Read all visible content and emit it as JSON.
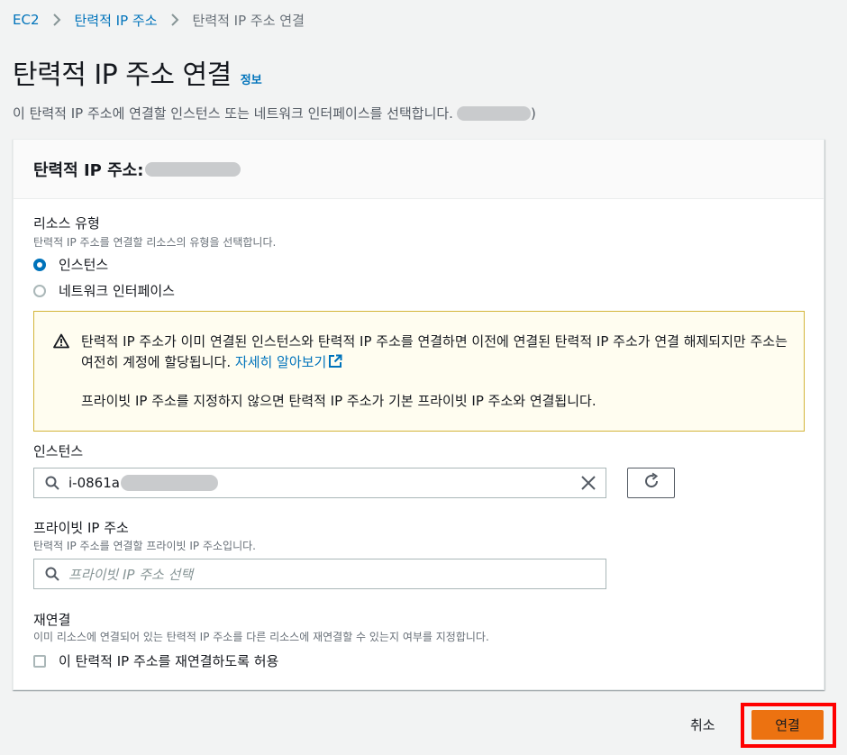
{
  "breadcrumb": {
    "items": [
      "EC2",
      "탄력적 IP 주소",
      "탄력적 IP 주소 연결"
    ]
  },
  "header": {
    "title": "탄력적 IP 주소 연결",
    "info_link": "정보",
    "subtitle": "이 탄력적 IP 주소에 연결할 인스턴스 또는 네트워크 인터페이스를 선택합니다.",
    "subtitle_suffix": ")"
  },
  "panel": {
    "title": "탄력적 IP 주소:"
  },
  "resource_type": {
    "label": "리소스 유형",
    "description": "탄력적 IP 주소를 연결할 리소스의 유형을 선택합니다.",
    "options": [
      "인스턴스",
      "네트워크 인터페이스"
    ],
    "selected": "인스턴스"
  },
  "alert": {
    "message_part1": "탄력적 IP 주소가 이미 연결된 인스턴스와 탄력적 IP 주소를 연결하면 이전에 연결된 탄력적 IP 주소가 연결 해제되지만 주소는 여전히 계정에 할당됩니다.",
    "learn_more": "자세히 알아보기",
    "message_part2": "프라이빗 IP 주소를 지정하지 않으면 탄력적 IP 주소가 기본 프라이빗 IP 주소와 연결됩니다."
  },
  "instance": {
    "label": "인스턴스",
    "value": "i-0861a"
  },
  "private_ip": {
    "label": "프라이빗 IP 주소",
    "description": "탄력적 IP 주소를 연결할 프라이빗 IP 주소입니다.",
    "placeholder": "프라이빗 IP 주소 선택"
  },
  "reassociation": {
    "label": "재연결",
    "description": "이미 리소스에 연결되어 있는 탄력적 IP 주소를 다른 리소스에 재연결할 수 있는지 여부를 지정합니다.",
    "checkbox_label": "이 탄력적 IP 주소를 재연결하도록 허용"
  },
  "actions": {
    "cancel": "취소",
    "associate": "연결"
  },
  "colors": {
    "link": "#0073bb",
    "primary": "#ec7211",
    "highlight": "#ff0000",
    "alert_bg": "#fffdf0"
  }
}
